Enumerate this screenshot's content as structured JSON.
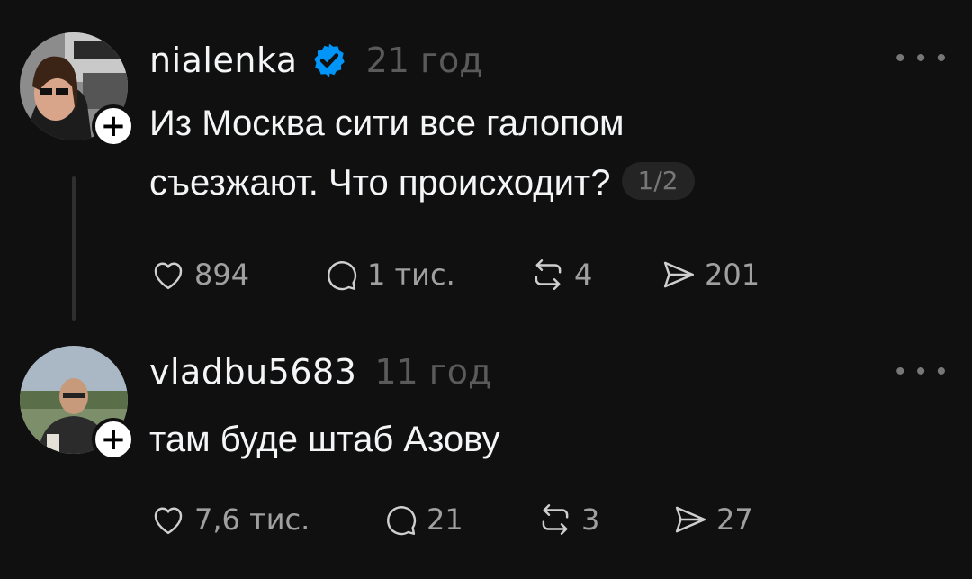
{
  "posts": [
    {
      "username": "nialenka",
      "verified": true,
      "time": "21 год",
      "text_lines": [
        "Из Москва сити все галопом",
        "съезжают. Что происходит?"
      ],
      "counter": "1/2",
      "likes": "894",
      "comments": "1 тис.",
      "reposts": "4",
      "shares": "201"
    },
    {
      "username": "vladbu5683",
      "verified": false,
      "time": "11 год",
      "text_lines": [
        "там буде штаб Азову"
      ],
      "likes": "7,6 тис.",
      "comments": "21",
      "reposts": "3",
      "shares": "27"
    }
  ],
  "icons": {
    "more": "more-icon",
    "verified": "verified-badge-icon",
    "follow": "plus-icon",
    "like": "heart-icon",
    "comment": "comment-icon",
    "repost": "repost-icon",
    "share": "send-icon"
  },
  "colors": {
    "background": "#101010",
    "text": "#f3f5f7",
    "muted": "#5a5a5a",
    "verified": "#0095f6"
  }
}
